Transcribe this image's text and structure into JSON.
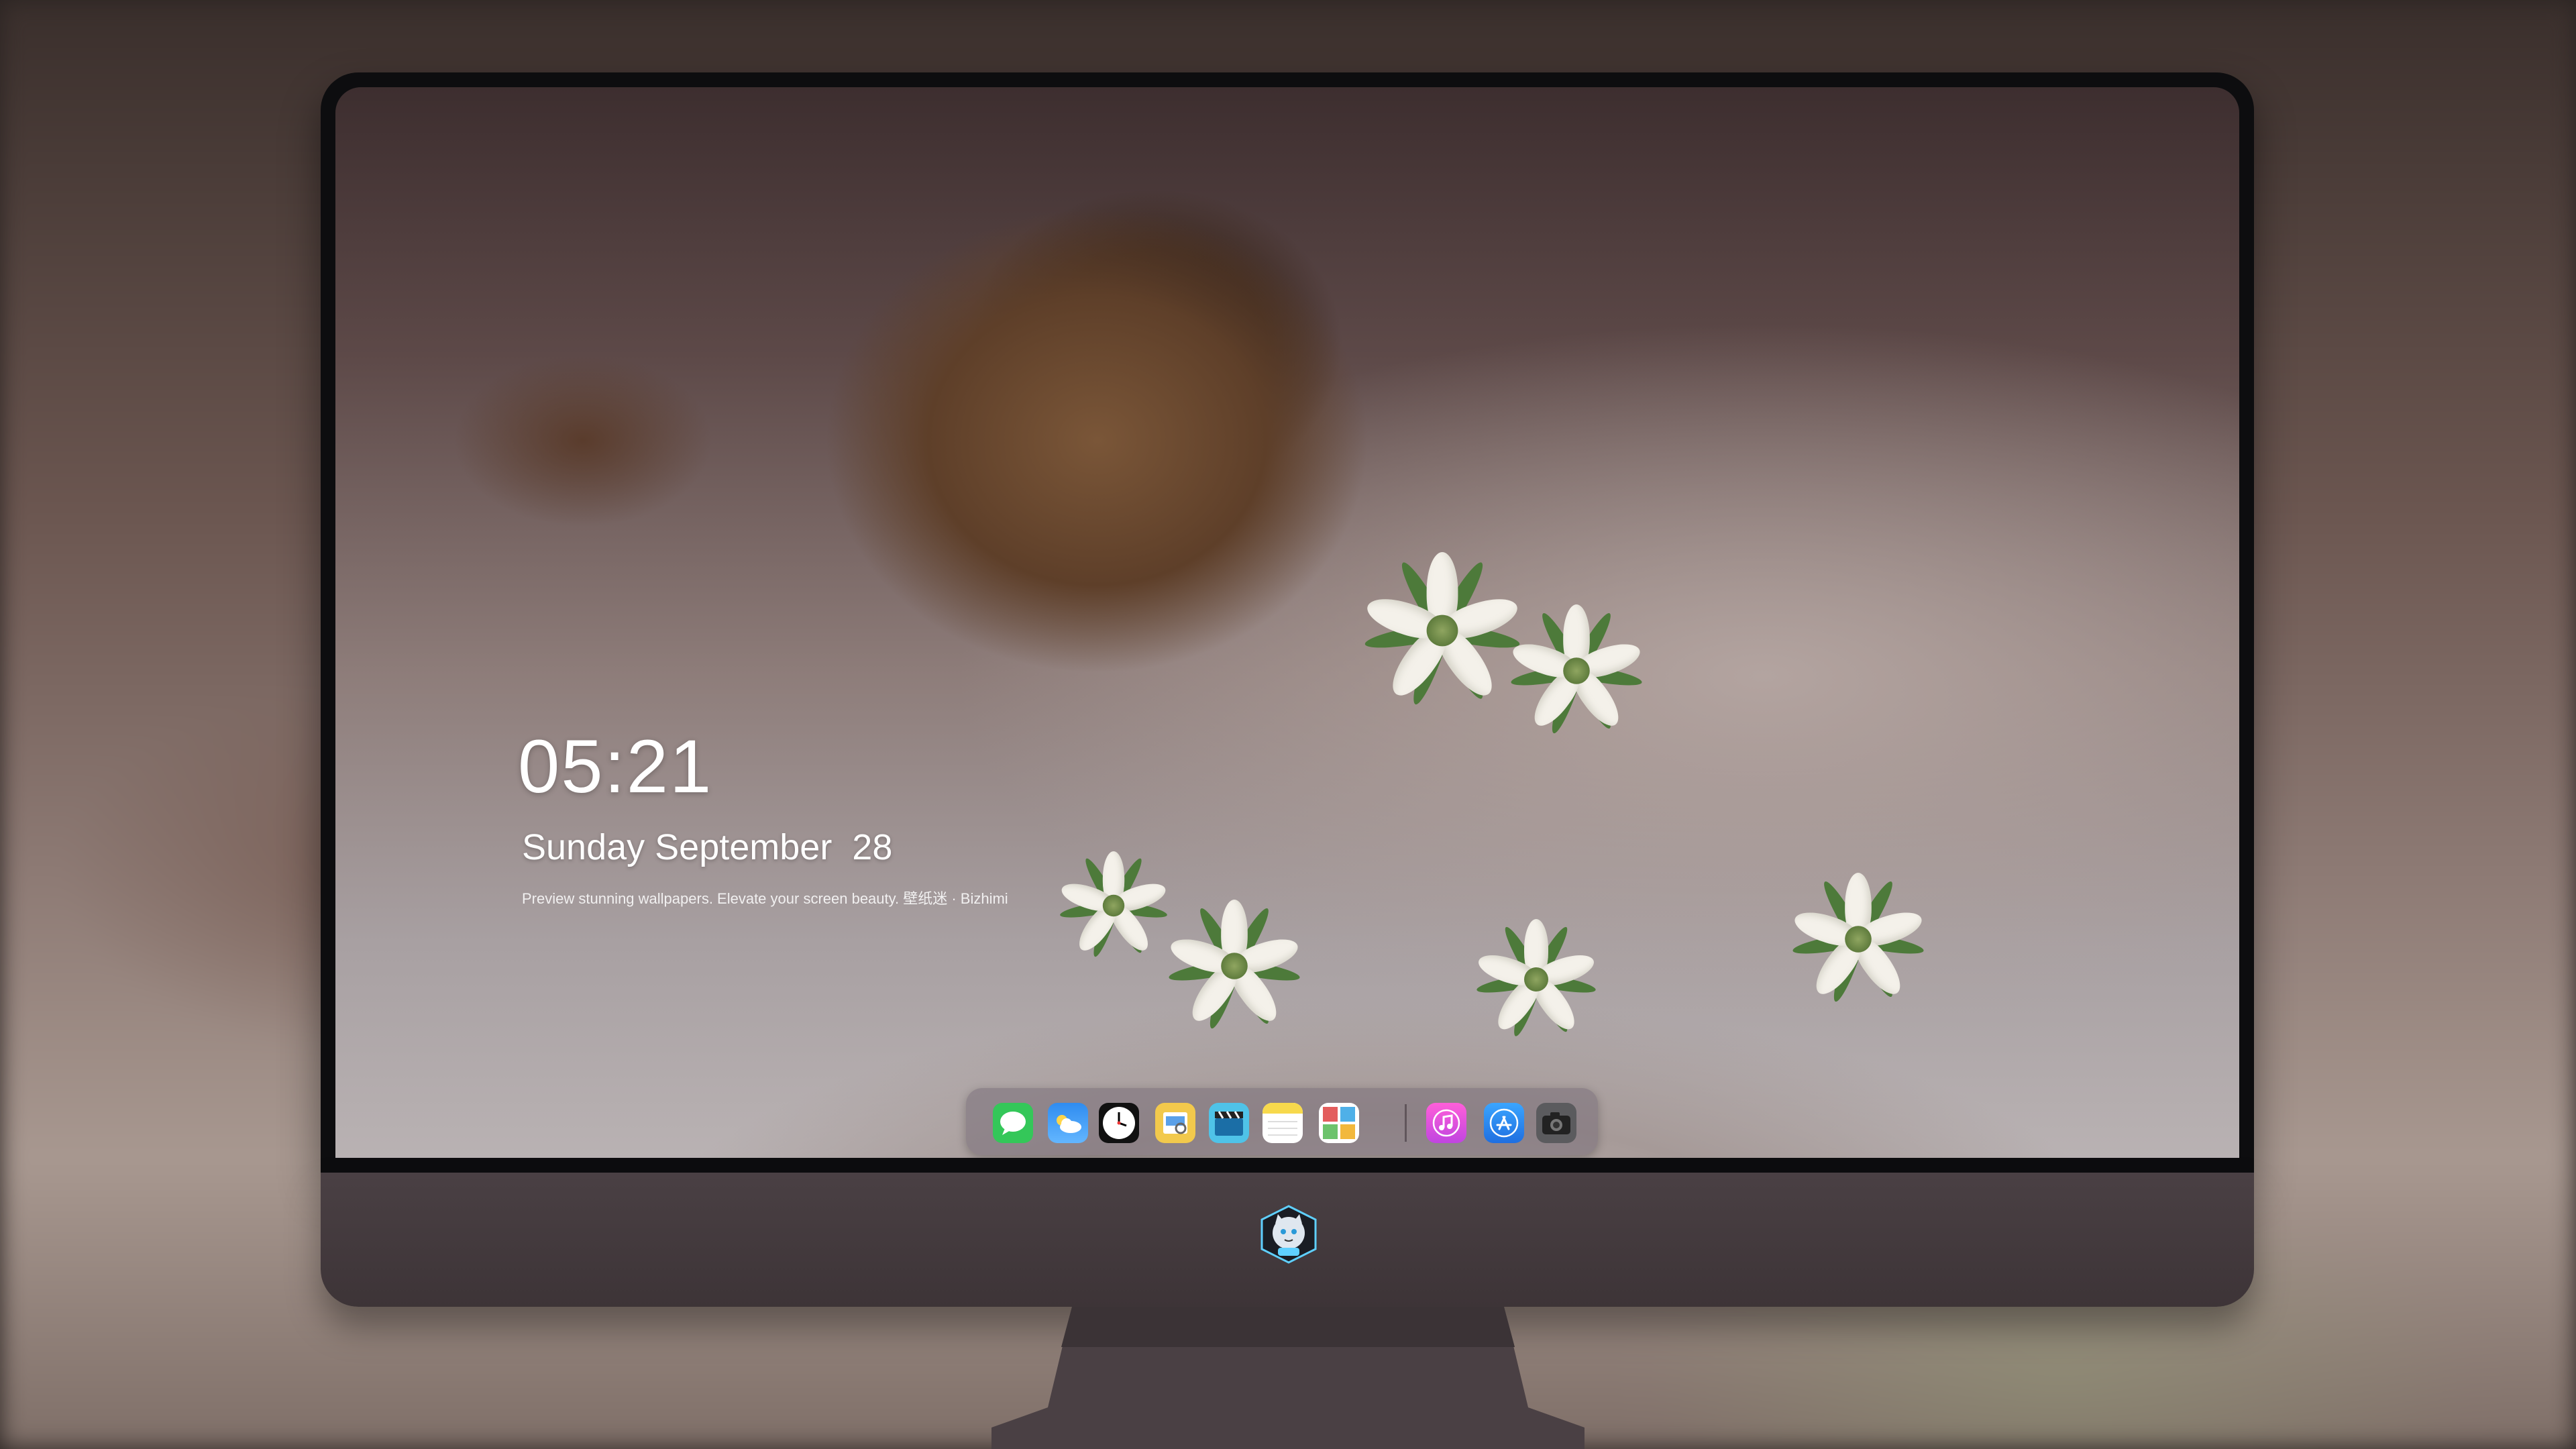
{
  "lock_screen": {
    "time": "05:21",
    "date": "Sunday September  28",
    "tagline": "Preview stunning wallpapers. Elevate your screen beauty. 壁纸迷 · Bizhimi"
  },
  "dock": {
    "apps": [
      {
        "name": "messages",
        "icon": "messages-icon",
        "color": "#34c759"
      },
      {
        "name": "weather",
        "icon": "weather-icon",
        "color": "#2f8cf0"
      },
      {
        "name": "clock",
        "icon": "clock-icon",
        "color": "#111111"
      },
      {
        "name": "preview",
        "icon": "preview-icon",
        "color": "#f2c94c"
      },
      {
        "name": "video",
        "icon": "clapper-icon",
        "color": "#4fc3e8"
      },
      {
        "name": "notes",
        "icon": "notes-icon",
        "color": "#f7d94c"
      },
      {
        "name": "photos",
        "icon": "photo-grid-icon",
        "color": "#e35d5d"
      },
      {
        "name": "music",
        "icon": "music-icon",
        "color": "#e84fd0"
      },
      {
        "name": "app-store",
        "icon": "app-store-icon",
        "color": "#2f8cf0"
      },
      {
        "name": "camera",
        "icon": "camera-icon",
        "color": "#555555"
      }
    ]
  },
  "device": {
    "logo": "cat-astronaut-logo-icon"
  }
}
